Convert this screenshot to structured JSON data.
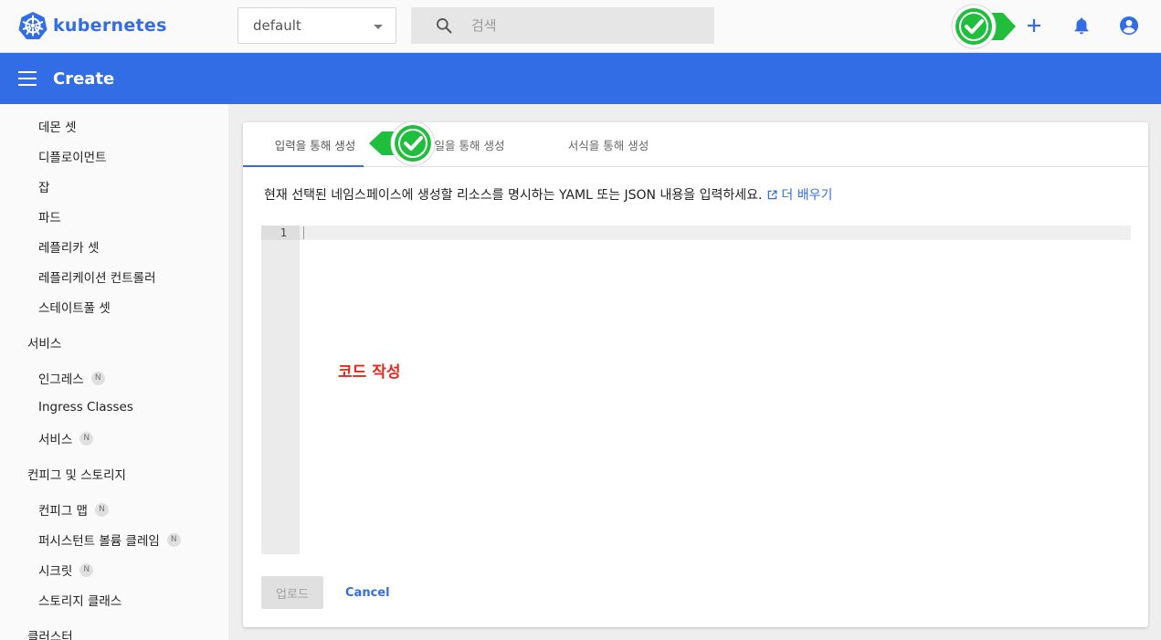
{
  "app": {
    "brand": "kubernetes",
    "brand_color": "#326de6"
  },
  "topbar": {
    "namespace_selected": "default",
    "search_placeholder": "검색",
    "icons": [
      "check-annotation-icon",
      "add-icon",
      "bell-icon",
      "account-icon"
    ]
  },
  "header": {
    "title": "Create"
  },
  "sidebar": {
    "items": [
      {
        "label": "데몬 셋",
        "type": "item"
      },
      {
        "label": "디플로이먼트",
        "type": "item"
      },
      {
        "label": "잡",
        "type": "item"
      },
      {
        "label": "파드",
        "type": "item"
      },
      {
        "label": "레플리카 셋",
        "type": "item"
      },
      {
        "label": "레플리케이션 컨트롤러",
        "type": "item"
      },
      {
        "label": "스테이트풀 셋",
        "type": "item"
      },
      {
        "label": "서비스",
        "type": "section"
      },
      {
        "label": "인그레스",
        "type": "item",
        "badge": "N"
      },
      {
        "label": "Ingress Classes",
        "type": "item"
      },
      {
        "label": "서비스",
        "type": "item",
        "badge": "N"
      },
      {
        "label": "컨피그 및 스토리지",
        "type": "section"
      },
      {
        "label": "컨피그 맵",
        "type": "item",
        "badge": "N"
      },
      {
        "label": "퍼시스턴트 볼륨 클레임",
        "type": "item",
        "badge": "N"
      },
      {
        "label": "시크릿",
        "type": "item",
        "badge": "N"
      },
      {
        "label": "스토리지 클래스",
        "type": "item"
      },
      {
        "label": "클러스터",
        "type": "section"
      }
    ]
  },
  "main": {
    "tabs": [
      {
        "label": "입력을 통해 생성",
        "active": true
      },
      {
        "label": "일을 통해 생성",
        "active": false
      },
      {
        "label": "서식을 통해 생성",
        "active": false
      }
    ],
    "description": "현재 선택된 네임스페이스에 생성할 리소스를 명시하는 YAML 또는 JSON 내용을 입력하세요.",
    "learn_more": "더 배우기",
    "editor": {
      "line_number": "1",
      "annotation": "코드 작성"
    },
    "upload_label": "업로드",
    "cancel_label": "Cancel"
  },
  "colors": {
    "accent": "#326de6",
    "annotation_green": "#1fbe3c",
    "annotation_red": "#e8271b"
  }
}
